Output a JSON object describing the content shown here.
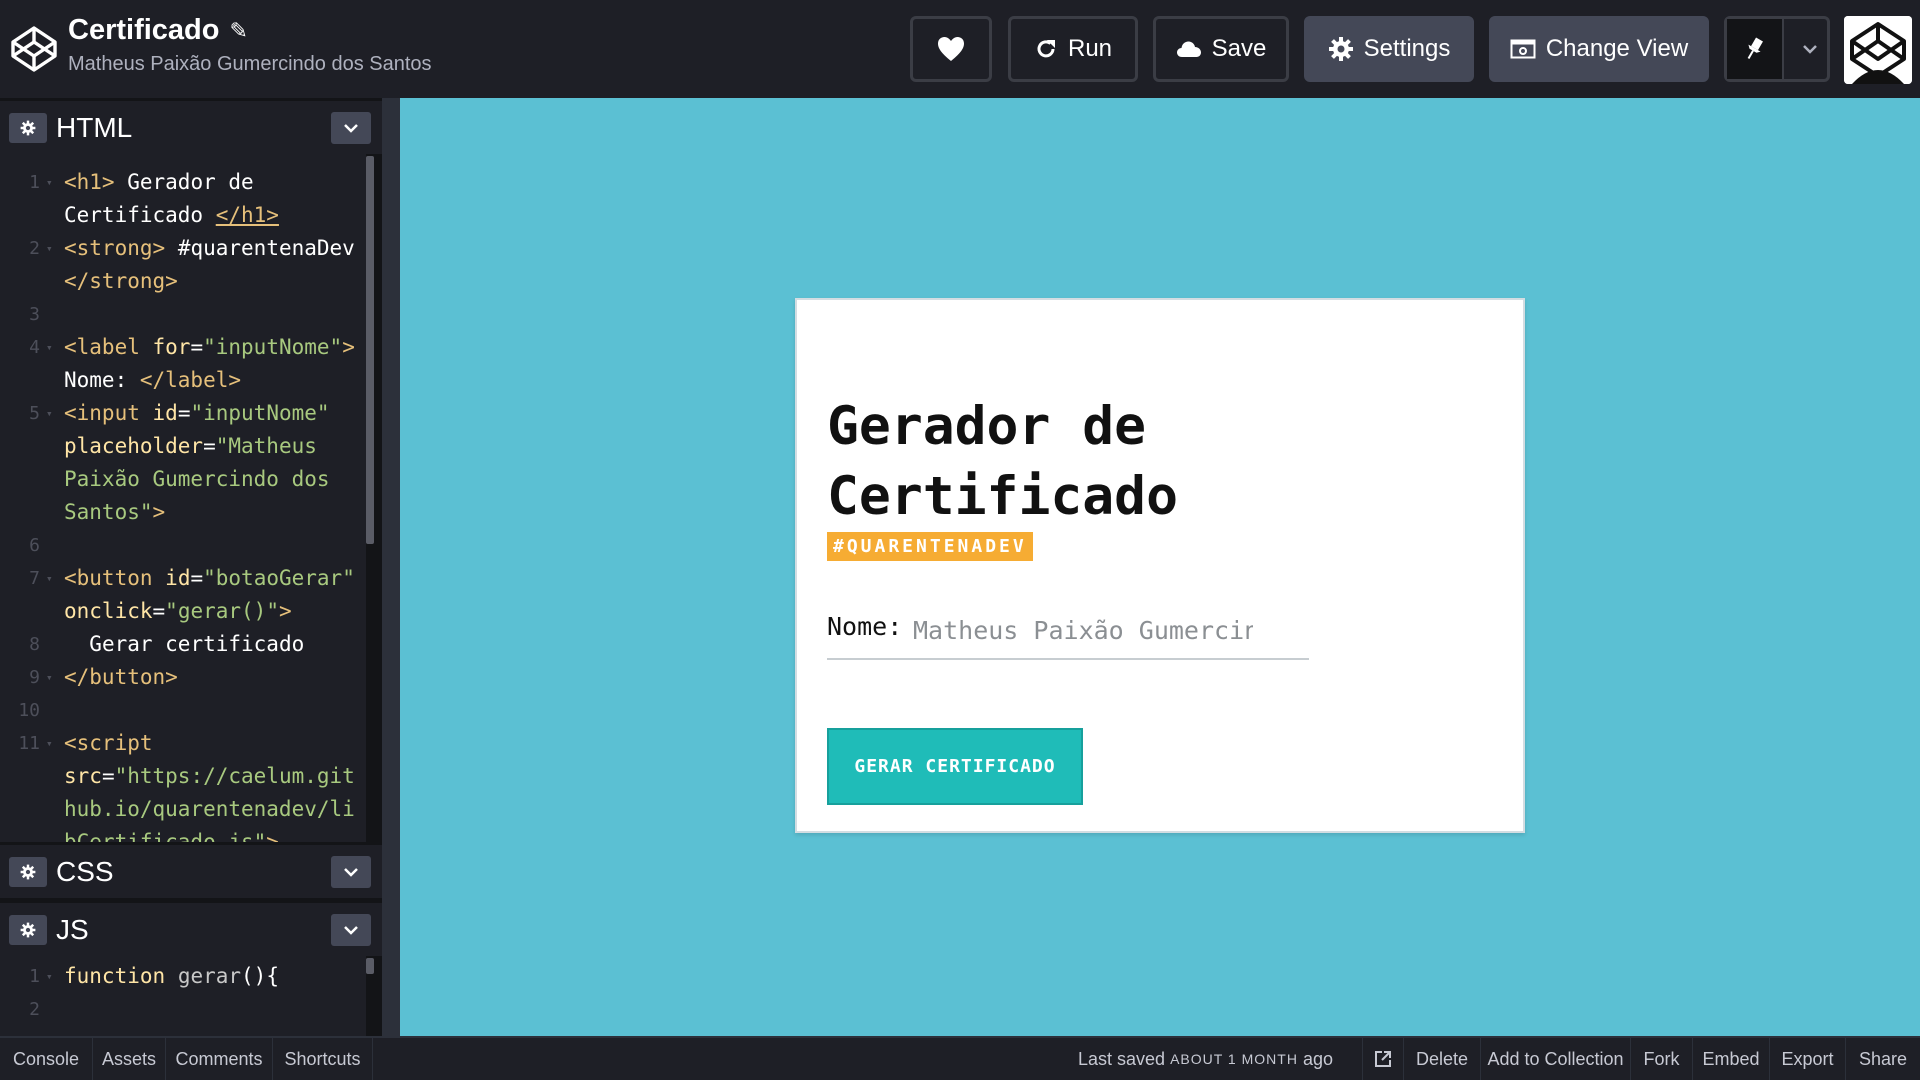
{
  "header": {
    "pen_title": "Certificado",
    "author": "Matheus Paixão Gumercindo dos Santos",
    "buttons": {
      "run": "Run",
      "save": "Save",
      "settings": "Settings",
      "change_view": "Change View"
    }
  },
  "editors": {
    "html": {
      "label": "HTML",
      "lines": [
        {
          "n": "1",
          "html": "<span class='tag'>&lt;h1&gt;</span> <span class='txt'>Gerador de</span>"
        },
        {
          "n": "",
          "html": "<span class='txt'>Certificado</span> <span class='tag' style='text-decoration:underline'>&lt;/h1&gt;</span>"
        },
        {
          "n": "2",
          "html": "<span class='tag'>&lt;strong&gt;</span> <span class='txt'>#quarentenaDev</span>"
        },
        {
          "n": "",
          "html": "<span class='tag'>&lt;/strong&gt;</span>"
        },
        {
          "n": "3",
          "html": ""
        },
        {
          "n": "4",
          "html": "<span class='tag'>&lt;label</span> <span class='attr'>for</span><span class='txt'>=</span><span class='val'>\"inputNome\"</span><span class='tag'>&gt;</span>"
        },
        {
          "n": "",
          "html": "<span class='txt'>Nome: </span><span class='tag'>&lt;/label&gt;</span>"
        },
        {
          "n": "5",
          "html": "<span class='tag'>&lt;input</span> <span class='attr'>id</span><span class='txt'>=</span><span class='val'>\"inputNome\"</span>"
        },
        {
          "n": "",
          "html": "<span class='attr'>placeholder</span><span class='txt'>=</span><span class='val'>\"Matheus</span>"
        },
        {
          "n": "",
          "html": "<span class='val'>Paixão Gumercindo dos</span>"
        },
        {
          "n": "",
          "html": "<span class='val'>Santos\"</span><span class='tag'>&gt;</span>"
        },
        {
          "n": "6",
          "html": ""
        },
        {
          "n": "7",
          "html": "<span class='tag'>&lt;button</span> <span class='attr'>id</span><span class='txt'>=</span><span class='val'>\"botaoGerar\"</span>"
        },
        {
          "n": "",
          "html": "<span class='attr'>onclick</span><span class='txt'>=</span><span class='val'>\"gerar()\"</span><span class='tag'>&gt;</span>"
        },
        {
          "n": "8",
          "html": "  <span class='txt'>Gerar certificado</span>"
        },
        {
          "n": "9",
          "html": "<span class='tag'>&lt;/button&gt;</span>"
        },
        {
          "n": "10",
          "html": ""
        },
        {
          "n": "11",
          "html": "<span class='tag'>&lt;script</span>"
        },
        {
          "n": "",
          "html": "<span class='attr'>src</span><span class='txt'>=</span><span class='val'>\"https://caelum.git</span>"
        },
        {
          "n": "",
          "html": "<span class='val'>hub.io/quarentenadev/li</span>"
        },
        {
          "n": "",
          "html": "<span class='val'>bCertificado.js\"</span><span class='tag'>&gt;</span>"
        }
      ]
    },
    "css": {
      "label": "CSS"
    },
    "js": {
      "label": "JS",
      "lines": [
        {
          "n": "1",
          "html": "<span class='kw'>function</span> <span class='fn'>gerar</span><span class='txt'>(){</span>"
        },
        {
          "n": "2",
          "html": ""
        }
      ]
    }
  },
  "preview": {
    "heading": "Gerador de Certificado",
    "badge": "#QUARENTENADEV",
    "nome_label": "Nome:",
    "nome_placeholder": "Matheus Paixão Gumercindo dos Santos",
    "button": "GERAR CERTIFICADO"
  },
  "footer": {
    "console": "Console",
    "assets": "Assets",
    "comments": "Comments",
    "shortcuts": "Shortcuts",
    "last_saved_prefix": "Last saved",
    "last_saved_time": "ABOUT 1 MONTH",
    "last_saved_suffix": "ago",
    "delete": "Delete",
    "add_to_collection": "Add to Collection",
    "fork": "Fork",
    "embed": "Embed",
    "export": "Export",
    "share": "Share"
  }
}
